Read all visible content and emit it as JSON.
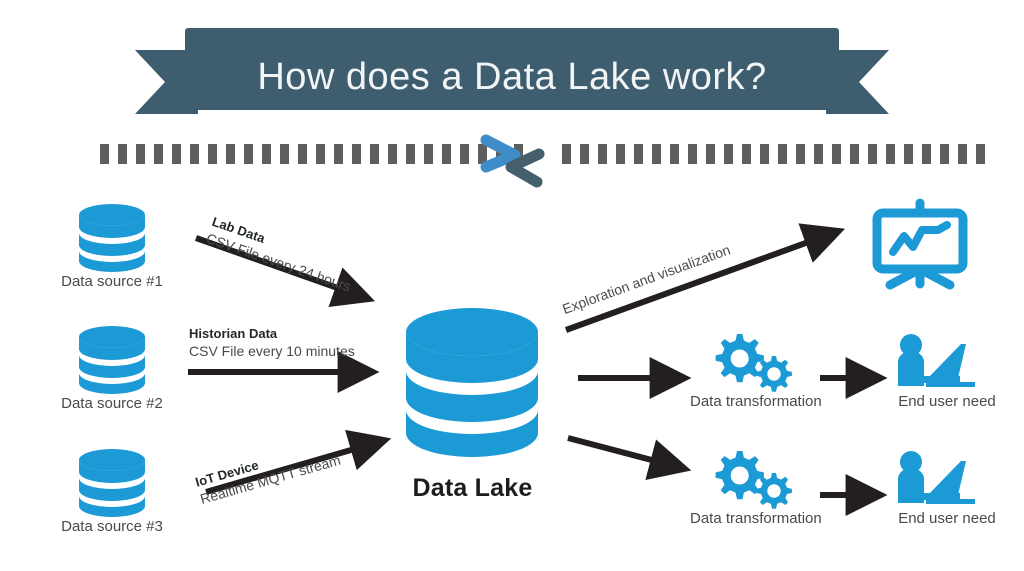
{
  "banner": {
    "title": "How does a Data Lake work?",
    "color": "#3e5d6e",
    "text_color": "#f2f5f6"
  },
  "divider": {
    "dash_color": "#5e5e5e",
    "dash_count_left": 24,
    "dash_count_right": 24,
    "logo": {
      "name": "chevron-pair-logo",
      "blue": "#3f8dc8",
      "dark": "#44606c"
    }
  },
  "theme": {
    "accent_blue": "#1b9ad6",
    "arrow_black": "#231f20",
    "label_gray": "#4a4a4a",
    "background": "#ffffff"
  },
  "sources": [
    {
      "id": "source-1",
      "label": "Data source #1",
      "icon": "database-icon",
      "flow": {
        "title": "Lab Data",
        "detail": "CSV File every 24 hours"
      }
    },
    {
      "id": "source-2",
      "label": "Data source #2",
      "icon": "database-icon",
      "flow": {
        "title": "Historian Data",
        "detail": "CSV File every 10 minutes"
      }
    },
    {
      "id": "source-3",
      "label": "Data source #3",
      "icon": "database-icon",
      "flow": {
        "title": "IoT Device",
        "detail": "Realtime MQTT stream"
      }
    }
  ],
  "lake": {
    "label": "Data Lake",
    "icon": "database-icon"
  },
  "outputs": {
    "exploration": {
      "arrow_label": "Exploration and visualization",
      "icon": "presentation-chart-icon"
    },
    "branches": [
      {
        "id": "branch-top",
        "transform_label": "Data transformation",
        "transform_icon": "gears-icon",
        "user_label": "End user need",
        "user_icon": "person-laptop-icon"
      },
      {
        "id": "branch-bottom",
        "transform_label": "Data transformation",
        "transform_icon": "gears-icon",
        "user_label": "End user need",
        "user_icon": "person-laptop-icon"
      }
    ]
  }
}
